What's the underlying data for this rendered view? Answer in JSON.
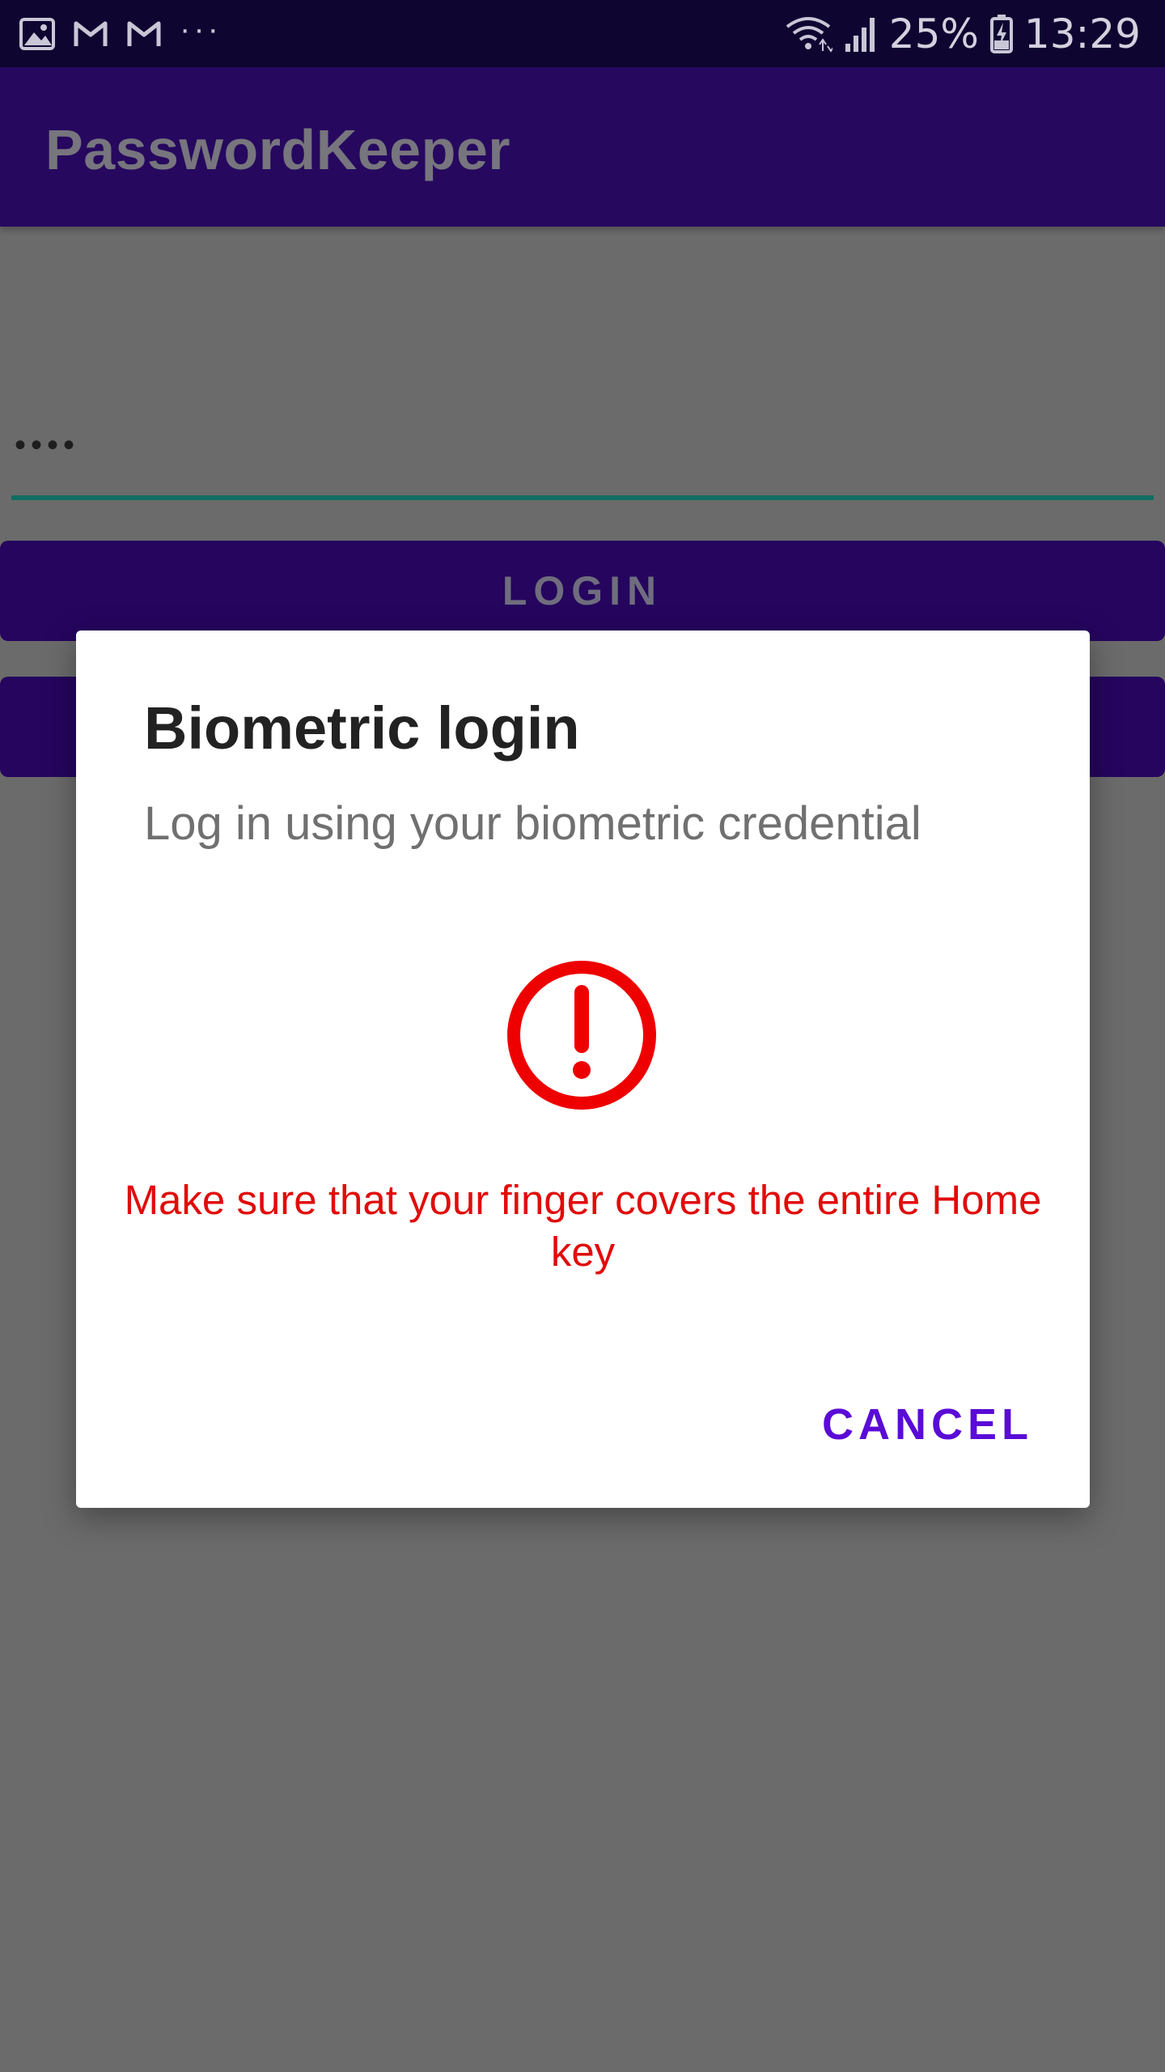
{
  "status_bar": {
    "notification_icons": [
      "gallery-icon",
      "gmail-icon",
      "gmail-icon"
    ],
    "more_indicator": "···",
    "battery_percent": "25%",
    "time": "13:29"
  },
  "app_bar": {
    "title": "PasswordKeeper"
  },
  "form": {
    "password_value": "••••",
    "login_button_label": "LOGIN",
    "second_button_label": ""
  },
  "dialog": {
    "title": "Biometric login",
    "subtitle": "Log in using your biometric credential",
    "error_icon": "error-exclamation-icon",
    "error_message": "Make sure that your finger covers the entire Home key",
    "cancel_label": "CANCEL"
  },
  "colors": {
    "status_bar": "#0f0531",
    "app_bar": "#26085f",
    "scrim_background": "#6b6b6b",
    "accent_underline": "#116e62",
    "error": "#e10b0b",
    "cancel_accent": "#5a0bd6"
  }
}
